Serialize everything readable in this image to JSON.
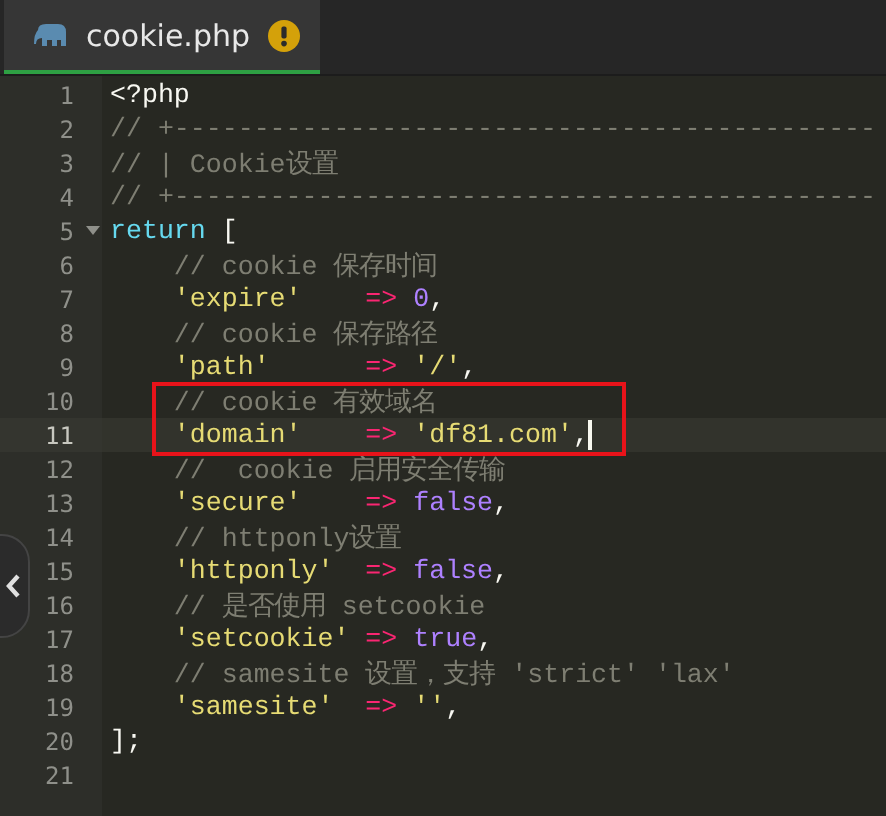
{
  "tabs": [
    {
      "label": "cookie.php",
      "selected": true,
      "warning": true
    }
  ],
  "lines": [
    {
      "number": "1",
      "tokens": [
        {
          "kind": "plain",
          "text": "<?php"
        }
      ]
    },
    {
      "number": "2",
      "tokens": [
        {
          "kind": "comment",
          "text": "// +--------------------------------------------"
        }
      ]
    },
    {
      "number": "3",
      "tokens": [
        {
          "kind": "comment",
          "text": "// | Cookie设置"
        }
      ]
    },
    {
      "number": "4",
      "tokens": [
        {
          "kind": "comment",
          "text": "// +--------------------------------------------"
        }
      ]
    },
    {
      "number": "5",
      "foldable": true,
      "tokens": [
        {
          "kind": "keyword",
          "text": "return"
        },
        {
          "kind": "plain",
          "text": " ["
        }
      ]
    },
    {
      "number": "6",
      "tokens": [
        {
          "kind": "comment",
          "text": "    // cookie 保存时间"
        }
      ]
    },
    {
      "number": "7",
      "tokens": [
        {
          "kind": "string",
          "text": "    'expire'"
        },
        {
          "kind": "operator",
          "text": "    =>"
        },
        {
          "kind": "constant",
          "text": " 0"
        },
        {
          "kind": "plain",
          "text": ","
        }
      ]
    },
    {
      "number": "8",
      "tokens": [
        {
          "kind": "comment",
          "text": "    // cookie 保存路径"
        }
      ]
    },
    {
      "number": "9",
      "tokens": [
        {
          "kind": "string",
          "text": "    'path'"
        },
        {
          "kind": "operator",
          "text": "      =>"
        },
        {
          "kind": "string",
          "text": " '/'"
        },
        {
          "kind": "plain",
          "text": ","
        }
      ]
    },
    {
      "number": "10",
      "boxed": true,
      "tokens": [
        {
          "kind": "comment",
          "text": "    // cookie 有效域名"
        }
      ]
    },
    {
      "number": "11",
      "boxed": true,
      "current": true,
      "tokens": [
        {
          "kind": "string",
          "text": "    'domain'"
        },
        {
          "kind": "operator",
          "text": "    =>"
        },
        {
          "kind": "string",
          "text": " 'df81.com'"
        },
        {
          "kind": "plain",
          "text": ","
        }
      ]
    },
    {
      "number": "12",
      "tokens": [
        {
          "kind": "comment",
          "text": "    //  cookie 启用安全传输"
        }
      ]
    },
    {
      "number": "13",
      "tokens": [
        {
          "kind": "string",
          "text": "    'secure'"
        },
        {
          "kind": "operator",
          "text": "    =>"
        },
        {
          "kind": "constant",
          "text": " false"
        },
        {
          "kind": "plain",
          "text": ","
        }
      ]
    },
    {
      "number": "14",
      "tokens": [
        {
          "kind": "comment",
          "text": "    // httponly设置"
        }
      ]
    },
    {
      "number": "15",
      "tokens": [
        {
          "kind": "string",
          "text": "    'httponly'"
        },
        {
          "kind": "operator",
          "text": "  =>"
        },
        {
          "kind": "constant",
          "text": " false"
        },
        {
          "kind": "plain",
          "text": ","
        }
      ]
    },
    {
      "number": "16",
      "tokens": [
        {
          "kind": "comment",
          "text": "    // 是否使用 setcookie"
        }
      ]
    },
    {
      "number": "17",
      "tokens": [
        {
          "kind": "string",
          "text": "    'setcookie'"
        },
        {
          "kind": "operator",
          "text": " =>"
        },
        {
          "kind": "constant",
          "text": " true"
        },
        {
          "kind": "plain",
          "text": ","
        }
      ]
    },
    {
      "number": "18",
      "tokens": [
        {
          "kind": "comment",
          "text": "    // samesite 设置，支持 'strict' 'lax'"
        }
      ]
    },
    {
      "number": "19",
      "tokens": [
        {
          "kind": "string",
          "text": "    'samesite'"
        },
        {
          "kind": "operator",
          "text": "  =>"
        },
        {
          "kind": "string",
          "text": " ''"
        },
        {
          "kind": "plain",
          "text": ","
        }
      ]
    },
    {
      "number": "20",
      "tokens": [
        {
          "kind": "plain",
          "text": "];"
        }
      ]
    },
    {
      "number": "21"
    }
  ],
  "side_handle": {
    "collapsed": true
  }
}
